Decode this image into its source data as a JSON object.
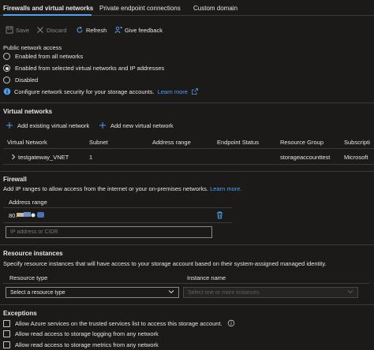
{
  "tabs": [
    {
      "label": "Firewalls and virtual networks",
      "active": true
    },
    {
      "label": "Private endpoint connections"
    },
    {
      "label": "Custom domain"
    }
  ],
  "toolbar": {
    "save_label": "Save",
    "discard_label": "Discard",
    "refresh_label": "Refresh",
    "feedback_label": "Give feedback"
  },
  "public_access": {
    "title": "Public network access",
    "options": [
      "Enabled from all networks",
      "Enabled from selected virtual networks and IP addresses",
      "Disabled"
    ],
    "selected_index": 1,
    "info_text": "Configure network security for your storage accounts.",
    "learn_more": "Learn more"
  },
  "virtual_networks": {
    "title": "Virtual networks",
    "add_existing": "Add existing virtual network",
    "add_new": "Add new virtual network",
    "columns": [
      "Virtual Network",
      "Subnet",
      "Address range",
      "Endpoint Status",
      "Resource Group",
      "Subscripti"
    ],
    "rows": [
      {
        "network": "testgateway_VNET",
        "subnet": "1",
        "address_range": "",
        "endpoint_status": "",
        "resource_group": "storageaccounttest",
        "subscription": "Microsoft"
      }
    ]
  },
  "firewall": {
    "title": "Firewall",
    "description": "Add IP ranges to allow access from the internet or your on-premises networks.",
    "learn_more": "Learn more.",
    "column": "Address range",
    "entry_prefix": "80.",
    "input_placeholder": "IP address or CIDR"
  },
  "resource_instances": {
    "title": "Resource instances",
    "description": "Specify resource instances that will have access to your storage account based on their system-assigned managed identity.",
    "col_type": "Resource type",
    "col_instance": "Instance name",
    "type_placeholder": "Select a resource type",
    "instance_placeholder": "Select one or more instances"
  },
  "exceptions": {
    "title": "Exceptions",
    "items": [
      "Allow Azure services on the trusted services list to access this storage account.",
      "Allow read access to storage logging from any network",
      "Allow read access to storage metrics from any network"
    ]
  },
  "colors": {
    "accent": "#4ea1f3",
    "background": "#1b1a19",
    "text": "#e6e6e6",
    "disabled": "#8a8886"
  }
}
